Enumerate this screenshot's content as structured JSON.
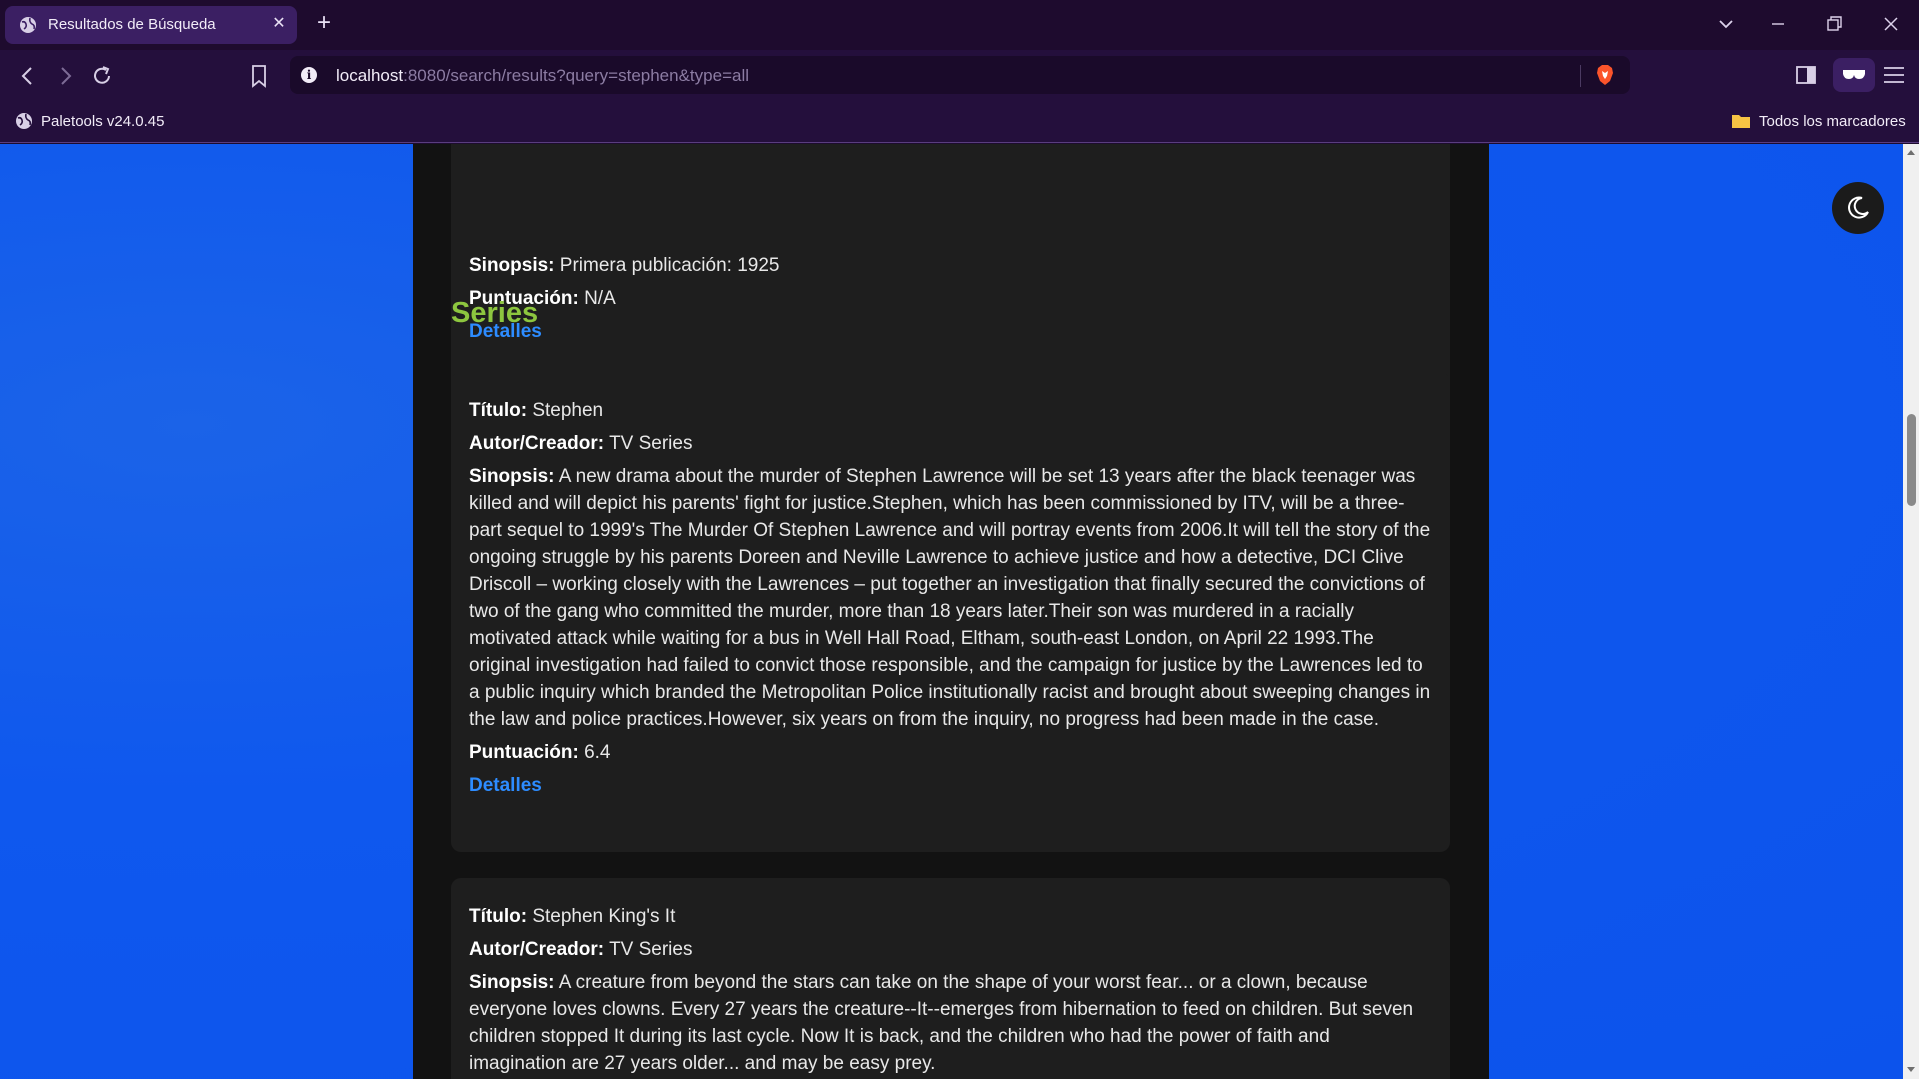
{
  "browser": {
    "tab_title": "Resultados de Búsqueda",
    "url_host": "localhost",
    "url_rest": ":8080/search/results?query=stephen&type=all",
    "bookmarks": {
      "left_item": "Paletools v24.0.45",
      "right_item": "Todos los marcadores"
    },
    "icons": [
      "globe-icon",
      "close-icon",
      "plus-icon",
      "chevron-down-icon",
      "minimize-icon",
      "restore-icon",
      "back-icon",
      "forward-icon",
      "reload-icon",
      "bookmark-icon",
      "info-icon",
      "brave-shield-icon",
      "sidebar-icon",
      "wallet-icon",
      "menu-icon",
      "folder-icon"
    ],
    "colors": {
      "tab_bar": "#1e0b2e",
      "toolbar": "#240f3c",
      "active_tab": "#3b1f63"
    }
  },
  "page": {
    "labels": {
      "title": "Título:",
      "author": "Autor/Creador:",
      "synopsis": "Sinopsis:",
      "score": "Puntuación:",
      "details": "Detalles"
    },
    "prev_card": {
      "synopsis": "Primera publicación: 1925",
      "score": "N/A"
    },
    "series_heading": "Series",
    "series": [
      {
        "title": "Stephen",
        "author": "TV Series",
        "synopsis": "A new drama about the murder of Stephen Lawrence will be set 13 years after the black teenager was killed and will depict his parents' fight for justice.Stephen, which has been commissioned by ITV, will be a three-part sequel to 1999's The Murder Of Stephen Lawrence and will portray events from 2006.It will tell the story of the ongoing struggle by his parents Doreen and Neville Lawrence to achieve justice and how a detective, DCI Clive Driscoll – working closely with the Lawrences – put together an investigation that finally secured the convictions of two of the gang who committed the murder, more than 18 years later.Their son was murdered in a racially motivated attack while waiting for a bus in Well Hall Road, Eltham, south-east London, on April 22 1993.The original investigation had failed to convict those responsible, and the campaign for justice by the Lawrences led to a public inquiry which branded the Metropolitan Police institutionally racist and brought about sweeping changes in the law and police practices.However, six years on from the inquiry, no progress had been made in the case.",
        "score": "6.4"
      },
      {
        "title": "Stephen King's It",
        "author": "TV Series",
        "synopsis": "A creature from beyond the stars can take on the shape of your worst fear... or a clown, because everyone loves clowns. Every 27 years the creature--It--emerges from hibernation to feed on children. But seven children stopped It during its last cycle. Now It is back, and the children who had the power of faith and imagination are 27 years older... and may be easy prey."
      }
    ],
    "colors": {
      "background": "#0c53ec",
      "content": "#121212",
      "card": "#1e1e1e",
      "heading": "#8dc63f",
      "link": "#2d8cff"
    }
  }
}
